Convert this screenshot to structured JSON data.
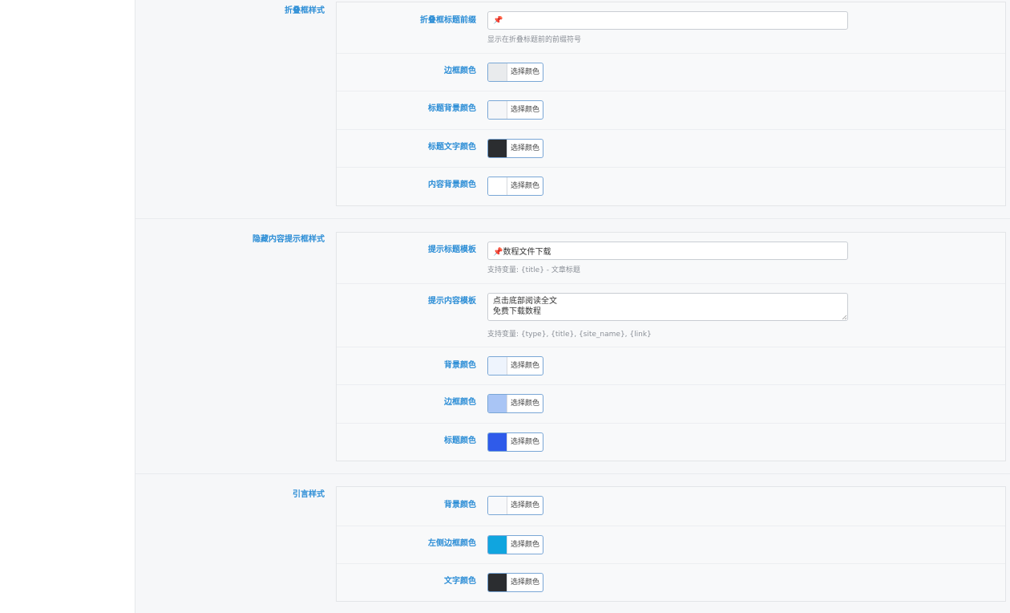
{
  "color_button_label": "选择颜色",
  "sections": [
    {
      "title": "折叠框样式",
      "rows": [
        {
          "label": "折叠框标题前缀",
          "type": "text",
          "value": "📌",
          "help": "显示在折叠标题前的前缀符号"
        },
        {
          "label": "边框颜色",
          "type": "color",
          "color": "#e9ebed"
        },
        {
          "label": "标题背景颜色",
          "type": "color",
          "color": "#f5f6f8"
        },
        {
          "label": "标题文字颜色",
          "type": "color",
          "color": "#2b2d30"
        },
        {
          "label": "内容背景颜色",
          "type": "color",
          "color": "#ffffff"
        }
      ]
    },
    {
      "title": "隐藏内容提示框样式",
      "rows": [
        {
          "label": "提示标题模板",
          "type": "text",
          "value": "📌数程文件下载",
          "help": "支持变量: {title} - 文章标题"
        },
        {
          "label": "提示内容模板",
          "type": "textarea",
          "value": "点击底部阅读全文\n免费下载数程",
          "help": "支持变量: {type}, {title}, {site_name}, {link}"
        },
        {
          "label": "背景颜色",
          "type": "color",
          "color": "#eef4fd"
        },
        {
          "label": "边框颜色",
          "type": "color",
          "color": "#a9c5f5"
        },
        {
          "label": "标题颜色",
          "type": "color",
          "color": "#2f5bea"
        }
      ]
    },
    {
      "title": "引言样式",
      "rows": [
        {
          "label": "背景颜色",
          "type": "color",
          "color": "#f8f9fb"
        },
        {
          "label": "左侧边框颜色",
          "type": "color",
          "color": "#10a5df"
        },
        {
          "label": "文字颜色",
          "type": "color",
          "color": "#2b2d30"
        }
      ]
    }
  ]
}
